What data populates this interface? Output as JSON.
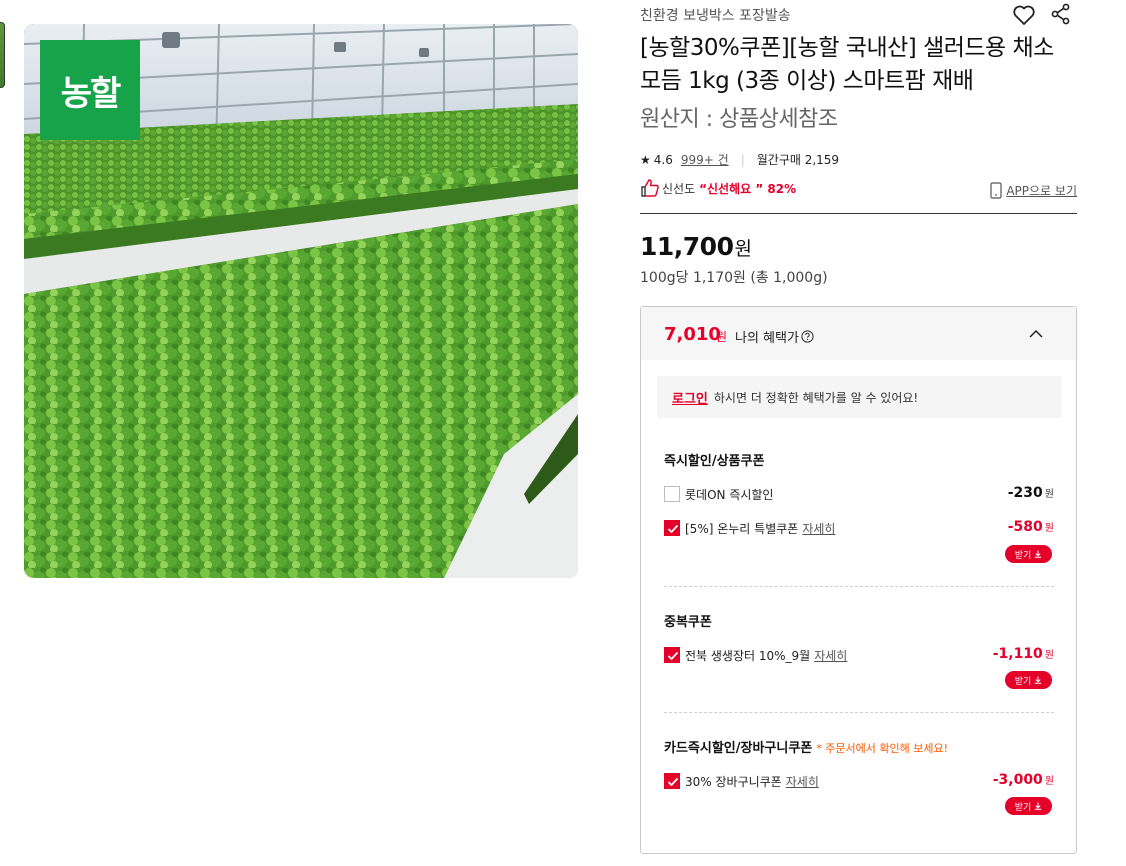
{
  "image": {
    "logo_text": "농할"
  },
  "product": {
    "shipping": "친환경 보냉박스 포장발송",
    "title": "[농할30%쿠폰][농할 국내산] 샐러드용 채소 모듬 1kg (3종 이상) 스마트팜 재배",
    "origin": "원산지 : 상품상세참조",
    "rating": "4.6",
    "review_count": "999+ 건",
    "monthly_sales": "월간구매 2,159",
    "freshness_label": "신선도",
    "freshness_value": "“신선해요 ” 82%",
    "app_link": "APP으로 보기",
    "price": "11,700",
    "price_unit": "원",
    "unit_price": "100g당 1,170원 (총 1,000g)"
  },
  "benefit": {
    "price": "7,010",
    "price_unit": "원",
    "label": "나의 혜택가",
    "login_link": "로그인",
    "login_text": "하시면 더 정확한 혜택가를 알 수 있어요!",
    "sections": [
      {
        "title": "즉시할인/상품쿠폰",
        "note": "",
        "coupons": [
          {
            "label": "롯데ON 즉시할인",
            "detail": "",
            "amount": "-230",
            "unit": "원",
            "checked": false,
            "receive": ""
          },
          {
            "label": "[5%] 온누리 특별쿠폰",
            "detail": "자세히",
            "amount": "-580",
            "unit": "원",
            "checked": true,
            "receive": "받기"
          }
        ]
      },
      {
        "title": "중복쿠폰",
        "note": "",
        "coupons": [
          {
            "label": "전북 생생장터 10%_9월",
            "detail": "자세히",
            "amount": "-1,110",
            "unit": "원",
            "checked": true,
            "receive": "받기"
          }
        ]
      },
      {
        "title": "카드즉시할인/장바구니쿠폰",
        "note": "* 주문서에서 확인해 보세요!",
        "coupons": [
          {
            "label": "30% 장바구니쿠폰",
            "detail": "자세히",
            "amount": "-3,000",
            "unit": "원",
            "checked": true,
            "receive": "받기"
          }
        ]
      }
    ]
  },
  "colors": {
    "accent_red": "#e5002a",
    "logo_green": "#16a34a",
    "note_orange": "#ff5a00"
  }
}
